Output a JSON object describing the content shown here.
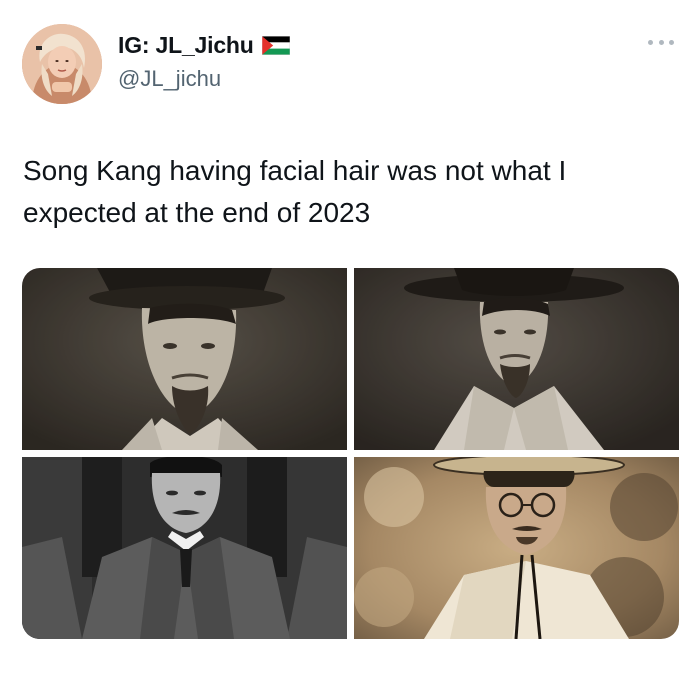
{
  "tweet": {
    "author": {
      "display_name": "IG: JL_Jichu",
      "handle": "@JL_jichu",
      "avatar_icon": "avatar-icon",
      "flag_icon": "palestine-flag-icon"
    },
    "more_icon": "more-dots-icon",
    "text": "Song Kang having facial hair was not what I expected at the end of 2023",
    "media": [
      {
        "name": "photo-1",
        "tone": "sepia-dark",
        "subject": "man in gat hat with goatee"
      },
      {
        "name": "photo-2",
        "tone": "sepia-dark",
        "subject": "man in gat hat with goatee"
      },
      {
        "name": "photo-3",
        "tone": "grayscale",
        "subject": "man in suit with mustache"
      },
      {
        "name": "photo-4",
        "tone": "warm-sepia",
        "subject": "man in wide hat with round glasses"
      }
    ]
  },
  "colors": {
    "text_primary": "#0f1419",
    "text_secondary": "#536471",
    "background": "#ffffff"
  }
}
